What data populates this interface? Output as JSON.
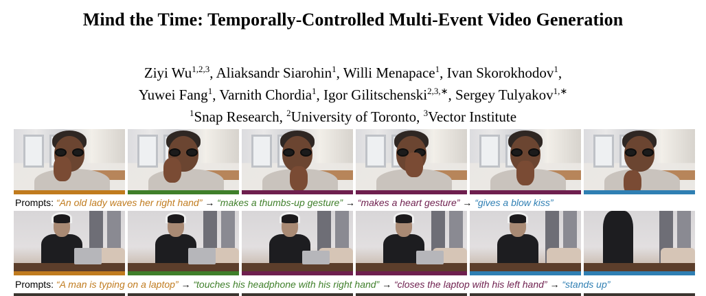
{
  "title": "Mind the Time: Temporally-Controlled Multi-Event Video Generation",
  "authors": {
    "line1": [
      {
        "name": "Ziyi Wu",
        "sup": "1,2,3",
        "sep": ", "
      },
      {
        "name": "Aliaksandr Siarohin",
        "sup": "1",
        "sep": ", "
      },
      {
        "name": "Willi Menapace",
        "sup": "1",
        "sep": ", "
      },
      {
        "name": "Ivan Skorokhodov",
        "sup": "1",
        "sep": ","
      }
    ],
    "line2": [
      {
        "name": "Yuwei Fang",
        "sup": "1",
        "sep": ", "
      },
      {
        "name": "Varnith Chordia",
        "sup": "1",
        "sep": ", "
      },
      {
        "name": "Igor Gilitschenski",
        "sup": "2,3,∗",
        "sep": ", "
      },
      {
        "name": "Sergey Tulyakov",
        "sup": "1,∗",
        "sep": ""
      }
    ]
  },
  "affiliations": [
    {
      "sup": "1",
      "name": "Snap Research",
      "sep": ", "
    },
    {
      "sup": "2",
      "name": "University of Toronto",
      "sep": ", "
    },
    {
      "sup": "3",
      "name": "Vector Institute",
      "sep": ""
    }
  ],
  "examples": [
    {
      "subject": "lady",
      "prompts_label": "Prompts:",
      "prompts": [
        {
          "text": "“An old lady waves her right hand”",
          "color": "#c07b1e"
        },
        {
          "text": "“makes a thumbs-up gesture”",
          "color": "#3f7f2a"
        },
        {
          "text": "“makes a heart gesture”",
          "color": "#6e1f4e"
        },
        {
          "text": "“gives a blow kiss”",
          "color": "#2f7fb3"
        }
      ],
      "frame_bar_colors": [
        "#c07b1e",
        "#3f7f2a",
        "#6e1f4e",
        "#6e1f4e",
        "#6e1f4e",
        "#2f7fb3"
      ]
    },
    {
      "subject": "man",
      "prompts_label": "Prompts:",
      "prompts": [
        {
          "text": "“A man is typing on a laptop”",
          "color": "#c07b1e"
        },
        {
          "text": "“touches his headphone with his right hand”",
          "color": "#3f7f2a"
        },
        {
          "text": "“closes the laptop with his left hand”",
          "color": "#6e1f4e"
        },
        {
          "text": "“stands up”",
          "color": "#2f7fb3"
        }
      ],
      "frame_bar_colors": [
        "#c07b1e",
        "#3f7f2a",
        "#6e1f4e",
        "#6e1f4e",
        "#2f7fb3",
        "#2f7fb3"
      ]
    }
  ],
  "arrow": "→"
}
